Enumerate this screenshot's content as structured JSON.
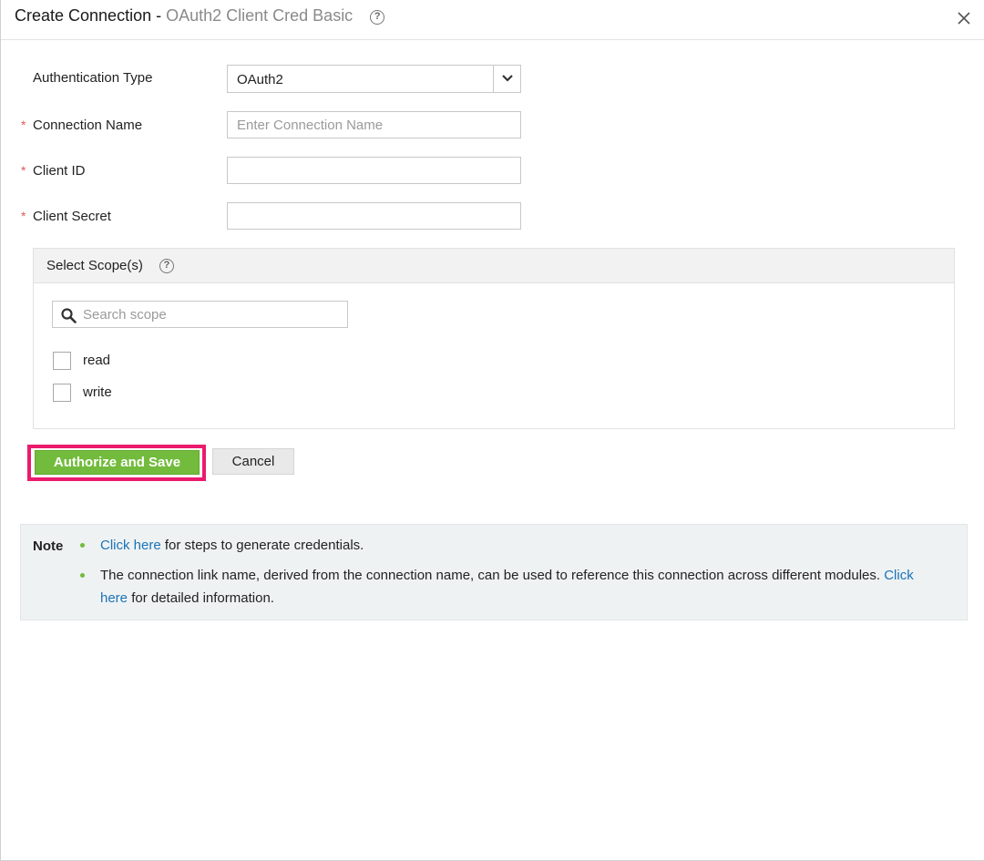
{
  "header": {
    "title": "Create Connection",
    "separator": " - ",
    "subtitle": "OAuth2 Client Cred Basic",
    "help_glyph": "?",
    "close_icon": "close-icon"
  },
  "form": {
    "auth_type": {
      "label": "Authentication Type",
      "value": "OAuth2",
      "options": [
        "OAuth2"
      ]
    },
    "connection_name": {
      "required_mark": "*",
      "label": "Connection Name",
      "value": "",
      "placeholder": "Enter Connection Name"
    },
    "client_id": {
      "required_mark": "*",
      "label": "Client ID",
      "value": "",
      "placeholder": ""
    },
    "client_secret": {
      "required_mark": "*",
      "label": "Client Secret",
      "value": "",
      "placeholder": ""
    }
  },
  "scopes": {
    "title": "Select Scope(s)",
    "help_glyph": "?",
    "search": {
      "placeholder": "Search scope",
      "value": ""
    },
    "items": [
      {
        "label": "read",
        "checked": false
      },
      {
        "label": "write",
        "checked": false
      }
    ]
  },
  "buttons": {
    "authorize_label": "Authorize and Save",
    "cancel_label": "Cancel"
  },
  "note": {
    "label": "Note",
    "item1": {
      "link": "Click here",
      "text": " for steps to generate credentials."
    },
    "item2": {
      "text_before": "The connection link name, derived from the connection name, can be used to reference this connection across different modules. ",
      "link": "Click here",
      "text_after": " for detailed information."
    }
  },
  "colors": {
    "primary_green": "#72bb3c",
    "highlight_pink": "#ea1a6e",
    "link_blue": "#1a73b8",
    "required_red": "#e05a5a"
  }
}
